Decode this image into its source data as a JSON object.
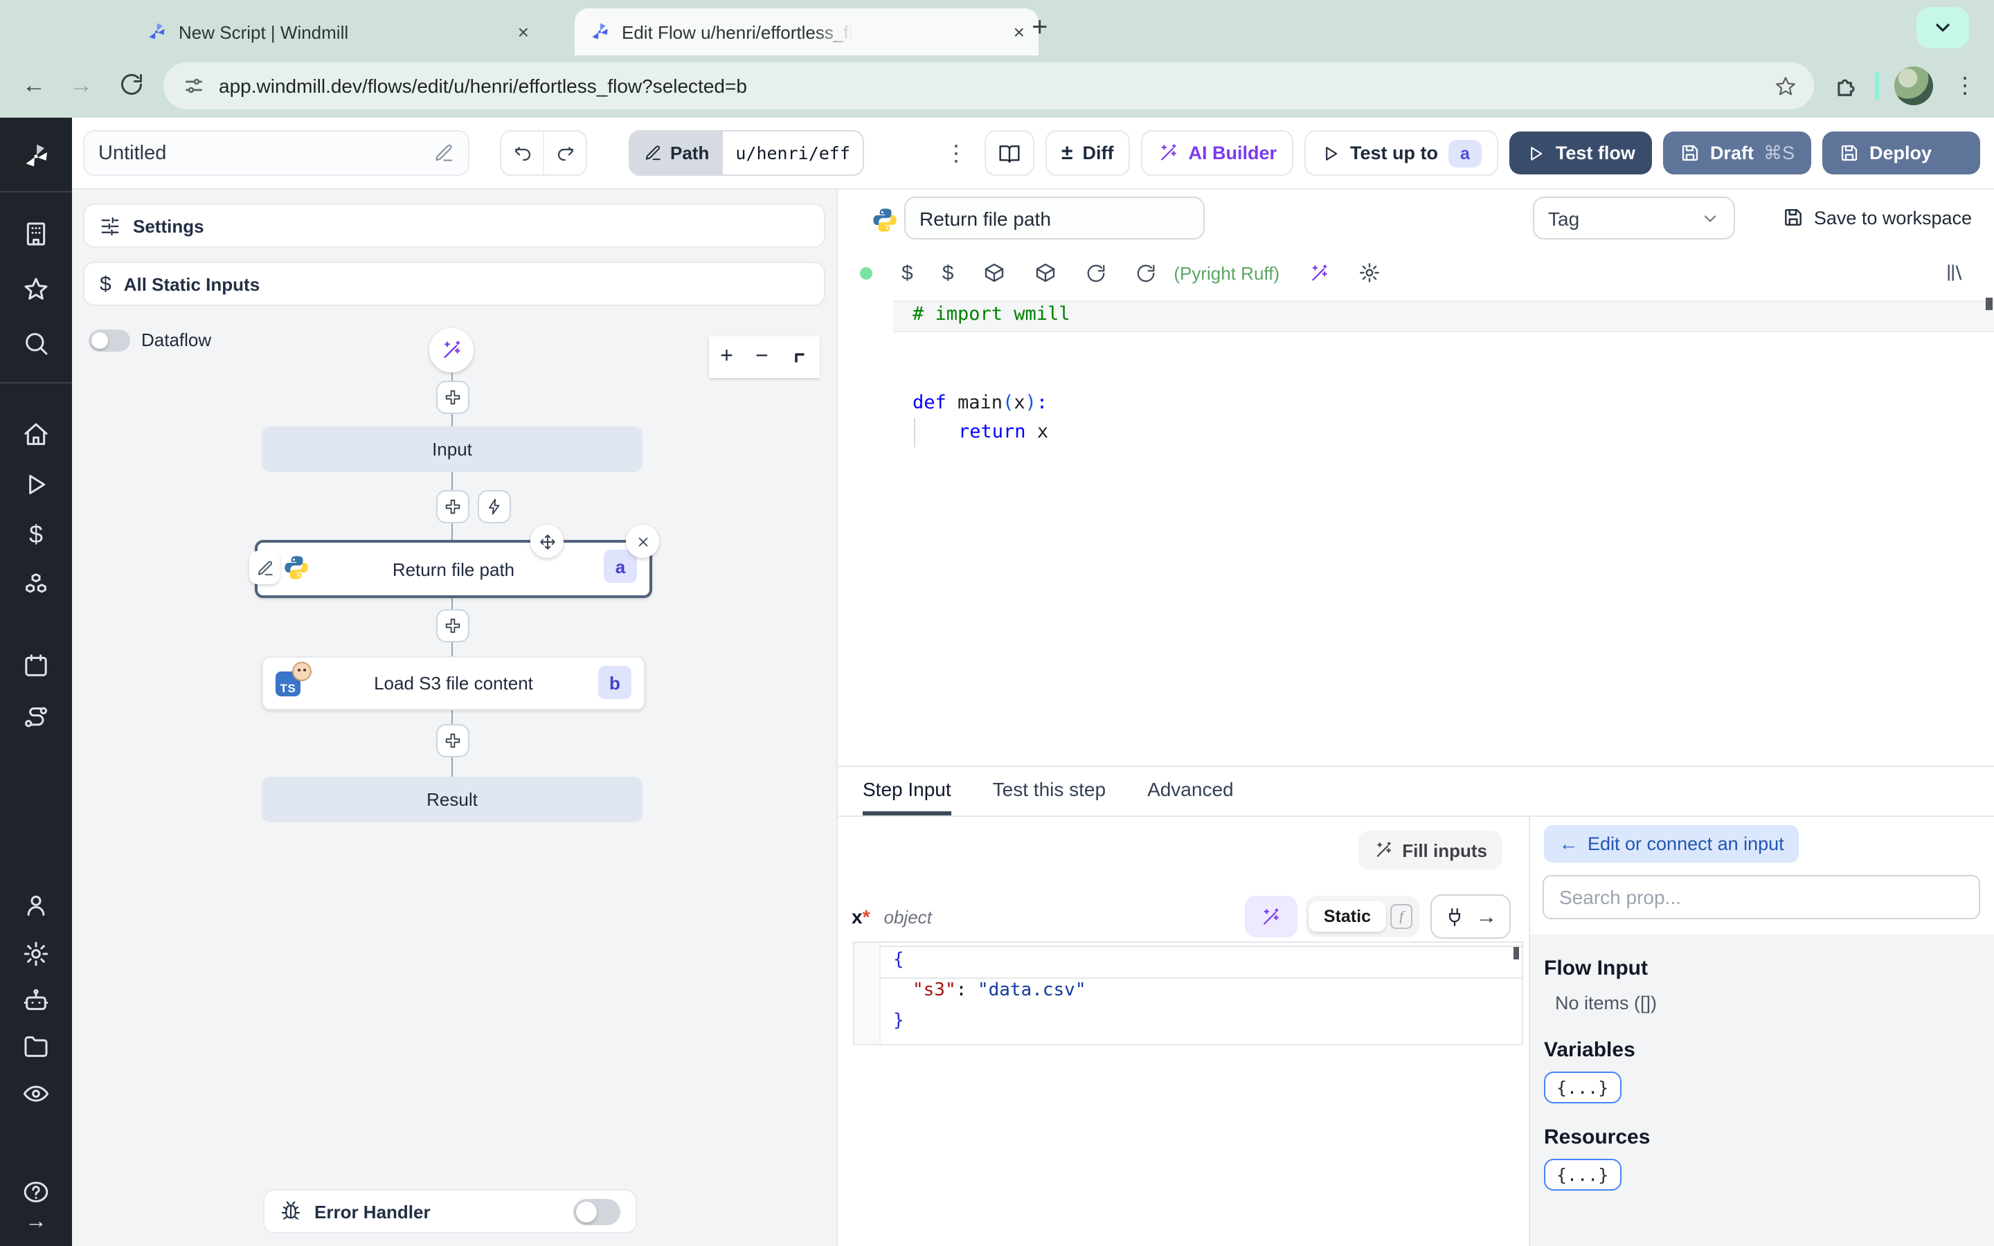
{
  "browser": {
    "tab1_title": "New Script | Windmill",
    "tab2_title": "Edit Flow u/henri/effortless_fl",
    "url": "app.windmill.dev/flows/edit/u/henri/effortless_flow?selected=b"
  },
  "glyphs": {
    "close": "×",
    "new_tab": "+",
    "kebab": "⋮",
    "back": "←",
    "forward": "→",
    "dollar": "$",
    "question": "?",
    "arrow_right": "→",
    "arrow_left": "←"
  },
  "toolbar": {
    "flow_name": "Untitled",
    "path_label": "Path",
    "path_value": "u/henri/eff",
    "diff_icon": "±",
    "diff": "Diff",
    "ai_builder": "AI Builder",
    "test_up_to": "Test up to",
    "test_up_to_badge": "a",
    "test_flow": "Test flow",
    "draft": "Draft",
    "draft_shortcut": "⌘S",
    "deploy": "Deploy"
  },
  "sidebar_icons": [
    "windmill-logo",
    "workspace-building",
    "favorites-star",
    "search",
    "home",
    "runs-play",
    "variables-dollar",
    "resources-cubes",
    "schedules-calendar",
    "flows-route",
    "users-person",
    "settings-gear",
    "workers-robot",
    "folders",
    "audit-eye",
    "help-question",
    "expand-arrow"
  ],
  "flow_panel": {
    "settings": "Settings",
    "all_static_inputs": "All Static Inputs",
    "dataflow": "Dataflow",
    "input_node": "Input",
    "step_a": {
      "label": "Return file path",
      "badge": "a"
    },
    "step_b": {
      "label": "Load S3 file content",
      "badge": "b",
      "lang": "TS"
    },
    "result_node": "Result",
    "error_handler": "Error Handler"
  },
  "step_editor": {
    "name": "Return file path",
    "tag": "Tag",
    "save_to_workspace": "Save to workspace",
    "lint": "(Pyright Ruff)",
    "code": {
      "comment": "# import wmill",
      "kw_def": "def",
      "fn_name": " main",
      "open_paren": "(",
      "arg": "x",
      "close_paren": ")",
      "colon": ":",
      "kw_return": "return",
      "return_val": " x"
    }
  },
  "bottom_tabs": {
    "step_input": "Step Input",
    "test_this_step": "Test this step",
    "advanced": "Advanced"
  },
  "step_input": {
    "fill_inputs": "Fill inputs",
    "arg_name": "x",
    "required_mark": "*",
    "arg_type": "object",
    "static_label": "Static",
    "fn_badge": "f",
    "json": {
      "open": "{",
      "key": "\"s3\"",
      "colon": ": ",
      "value": "\"data.csv\"",
      "close": "}"
    }
  },
  "connect_panel": {
    "edit_connect": "Edit or connect an input",
    "search_placeholder": "Search prop...",
    "flow_input": "Flow Input",
    "no_items": "No items ([])",
    "variables": "Variables",
    "resources": "Resources",
    "object_chip": "{...}"
  },
  "colors": {
    "chrome_bg": "#cfe1da",
    "active_tab": "#f7faf8",
    "sidebar_bg": "#1f232a",
    "accent_purple": "#7c3aed",
    "test_flow_btn": "#3a4c6b",
    "draft_deploy_btn": "#5f7499",
    "badge_bg": "#e0e4fb",
    "badge_text": "#4b4ddc",
    "node_gray": "#e0e7f0",
    "lint_green": "#59a661",
    "code_comment": "#008000",
    "code_keyword": "#0000ff",
    "json_key": "#a31515",
    "json_value": "#123a9b"
  }
}
